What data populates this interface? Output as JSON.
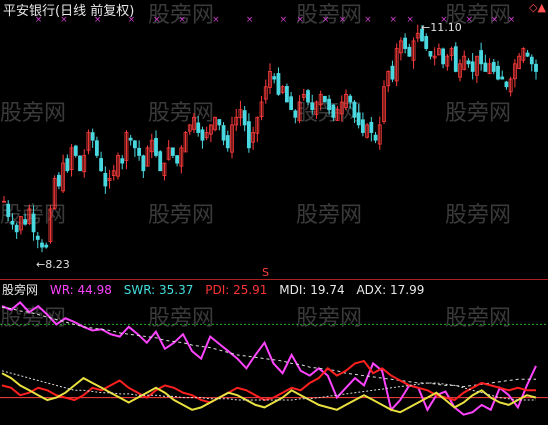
{
  "title": "平安银行(日线 前复权)",
  "high_label": "←11.10",
  "low_label": "←8.23",
  "marker_letter": "S",
  "watermark": "股旁网",
  "corner_icon": "diamond-up-icon",
  "indicator": {
    "name": "股旁网",
    "items": [
      {
        "label": "WR: 44.98",
        "color": "#ff44ff"
      },
      {
        "label": "SWR: 35.37",
        "color": "#44dddd"
      },
      {
        "label": "PDI: 25.91",
        "color": "#ff3333"
      },
      {
        "label": "MDI: 19.74",
        "color": "#e8e8e8"
      },
      {
        "label": "ADX: 17.99",
        "color": "#e8e8e8"
      }
    ]
  },
  "colors": {
    "up": "#ff3c3c",
    "down": "#4ad8e0",
    "wr": "#ff44ff",
    "pdi": "#ff2020",
    "mdi": "#e8e040",
    "adx": "#e0e0e0",
    "green_level": "#22aa22",
    "red_level": "#ff4040",
    "background": "#000000"
  },
  "chart_data": [
    {
      "type": "candlestick",
      "title": "平安银行(日线 前复权)",
      "max_price": 11.1,
      "min_price": 8.23,
      "y_range": [
        8.0,
        11.3
      ],
      "close_series": [
        8.9,
        8.7,
        8.6,
        8.5,
        8.7,
        8.6,
        8.8,
        8.5,
        8.4,
        8.3,
        8.3,
        8.8,
        9.2,
        9.1,
        9.4,
        9.3,
        9.6,
        9.5,
        9.3,
        9.5,
        9.8,
        9.7,
        9.5,
        9.3,
        9.1,
        9.2,
        9.3,
        9.5,
        9.4,
        9.8,
        9.7,
        9.6,
        9.5,
        9.3,
        9.6,
        9.7,
        9.5,
        9.3,
        9.4,
        9.6,
        9.5,
        9.4,
        9.6,
        9.8,
        9.9,
        10.0,
        9.8,
        9.7,
        9.8,
        9.9,
        10.0,
        9.9,
        9.7,
        9.6,
        9.9,
        10.0,
        10.1,
        9.9,
        9.6,
        9.8,
        10.0,
        10.2,
        10.4,
        10.6,
        10.5,
        10.3,
        10.4,
        10.2,
        10.1,
        10.0,
        10.2,
        10.3,
        10.2,
        10.1,
        10.2,
        10.3,
        10.2,
        10.1,
        10.0,
        10.1,
        10.2,
        10.3,
        10.2,
        10.0,
        9.9,
        9.8,
        9.9,
        9.8,
        9.7,
        9.9,
        10.4,
        10.6,
        10.5,
        10.9,
        11.0,
        10.9,
        10.8,
        11.0,
        11.1,
        11.0,
        10.9,
        10.8,
        10.8,
        10.9,
        10.7,
        10.8,
        10.9,
        10.6,
        10.7,
        10.8,
        10.7,
        10.6,
        10.8,
        10.7,
        10.6,
        10.7,
        10.6,
        10.5,
        10.5,
        10.4,
        10.5,
        10.7,
        10.8,
        10.9,
        10.8,
        10.7,
        10.6
      ]
    },
    {
      "type": "line",
      "title": "股旁网",
      "y_range": [
        0,
        100
      ],
      "levels": [
        {
          "value": 80,
          "color": "green"
        },
        {
          "value": 20,
          "color": "red"
        }
      ],
      "series": [
        {
          "name": "WR",
          "last": 44.98,
          "values": [
            95,
            92,
            98,
            90,
            95,
            88,
            80,
            85,
            82,
            78,
            75,
            76,
            72,
            70,
            78,
            72,
            65,
            74,
            60,
            65,
            72,
            58,
            52,
            70,
            64,
            58,
            52,
            44,
            55,
            65,
            48,
            40,
            55,
            42,
            38,
            44,
            38,
            20,
            28,
            36,
            30,
            48,
            42,
            10,
            18,
            30,
            28,
            10,
            22,
            25,
            12,
            6,
            8,
            14,
            10,
            28,
            22,
            12,
            30,
            46
          ]
        },
        {
          "name": "SWR",
          "last": 35.37,
          "values": [
            94,
            93,
            91,
            90,
            88,
            86,
            84,
            82,
            80,
            78,
            77,
            76,
            75,
            73,
            72,
            71,
            70,
            69,
            67,
            66,
            65,
            63,
            62,
            61,
            59,
            57,
            55,
            54,
            53,
            52,
            51,
            50,
            48,
            47,
            45,
            44,
            43,
            42,
            40,
            39,
            38,
            37,
            36,
            35,
            34,
            33,
            32,
            32,
            31,
            30,
            30,
            29,
            30,
            31,
            32,
            33,
            34,
            35,
            35,
            35
          ]
        },
        {
          "name": "PDI",
          "last": 25.91,
          "values": [
            30,
            28,
            22,
            24,
            28,
            26,
            22,
            20,
            18,
            22,
            28,
            26,
            30,
            34,
            28,
            24,
            20,
            26,
            30,
            28,
            24,
            22,
            18,
            16,
            20,
            24,
            28,
            26,
            22,
            18,
            20,
            24,
            28,
            26,
            32,
            36,
            44,
            38,
            42,
            48,
            50,
            40,
            44,
            38,
            34,
            30,
            28,
            26,
            22,
            20,
            18,
            24,
            28,
            32,
            30,
            28,
            26,
            28,
            26,
            26
          ]
        },
        {
          "name": "MDI",
          "last": 19.74,
          "values": [
            40,
            36,
            30,
            26,
            22,
            18,
            20,
            24,
            30,
            36,
            32,
            28,
            24,
            20,
            16,
            20,
            24,
            28,
            24,
            18,
            14,
            10,
            12,
            16,
            20,
            24,
            22,
            18,
            14,
            12,
            16,
            20,
            26,
            22,
            18,
            14,
            12,
            10,
            14,
            18,
            22,
            18,
            14,
            10,
            8,
            12,
            16,
            20,
            24,
            18,
            12,
            16,
            22,
            26,
            20,
            16,
            14,
            18,
            22,
            20
          ]
        },
        {
          "name": "ADX",
          "last": 17.99,
          "values": [
            42,
            40,
            38,
            36,
            34,
            32,
            30,
            28,
            26,
            26,
            25,
            24,
            24,
            23,
            23,
            22,
            22,
            22,
            21,
            21,
            20,
            20,
            20,
            19,
            19,
            19,
            18,
            18,
            18,
            18,
            18,
            18,
            18,
            19,
            19,
            20,
            21,
            22,
            23,
            24,
            25,
            26,
            27,
            28,
            29,
            30,
            31,
            32,
            32,
            31,
            30,
            28,
            26,
            24,
            22,
            20,
            19,
            18,
            18,
            18
          ]
        }
      ]
    }
  ]
}
